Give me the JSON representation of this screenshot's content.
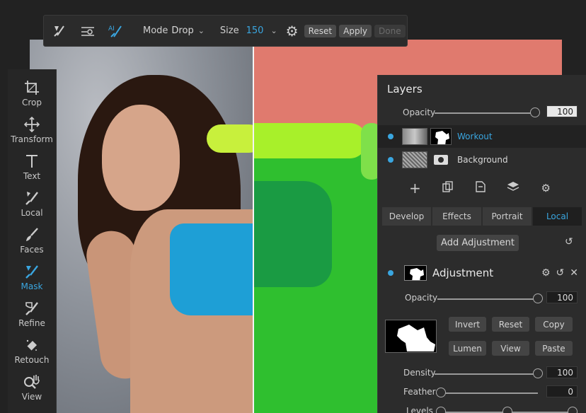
{
  "toolbar": {
    "mode_label": "Mode",
    "mode_value": "Drop",
    "size_label": "Size",
    "size_value": "150",
    "reset_label": "Reset",
    "apply_label": "Apply",
    "done_label": "Done",
    "tool_icons": [
      "mask-brush-icon",
      "mask-line-icon",
      "ai-mask-icon",
      "gear-icon"
    ]
  },
  "tools": [
    {
      "label": "Crop",
      "icon": "crop-icon"
    },
    {
      "label": "Transform",
      "icon": "move-icon"
    },
    {
      "label": "Text",
      "icon": "text-icon"
    },
    {
      "label": "Local",
      "icon": "brush-icon"
    },
    {
      "label": "Faces",
      "icon": "faces-brush-icon"
    },
    {
      "label": "Mask",
      "icon": "mask-icon",
      "active": true
    },
    {
      "label": "Refine",
      "icon": "refine-icon"
    },
    {
      "label": "Retouch",
      "icon": "eraser-icon"
    },
    {
      "label": "View",
      "icon": "zoom-hand-icon"
    }
  ],
  "layers_panel": {
    "title": "Layers",
    "opacity_label": "Opacity",
    "opacity_value": "100",
    "layers": [
      {
        "name": "Workout",
        "selected": true
      },
      {
        "name": "Background",
        "selected": false
      }
    ],
    "tabs": [
      "Develop",
      "Effects",
      "Portrait",
      "Local"
    ],
    "active_tab": "Local",
    "add_adjustment_label": "Add Adjustment"
  },
  "adjustment": {
    "title": "Adjustment",
    "opacity_label": "Opacity",
    "opacity_value": "100",
    "buttons": [
      "Invert",
      "Reset",
      "Copy",
      "Lumen",
      "View",
      "Paste"
    ],
    "density_label": "Density",
    "density_value": "100",
    "feather_label": "Feather",
    "feather_value": "0",
    "levels_label": "Levels"
  },
  "colors": {
    "accent": "#3aa6e0",
    "panel": "#2c2c2c",
    "mask_overlay": "#e07a6e"
  }
}
